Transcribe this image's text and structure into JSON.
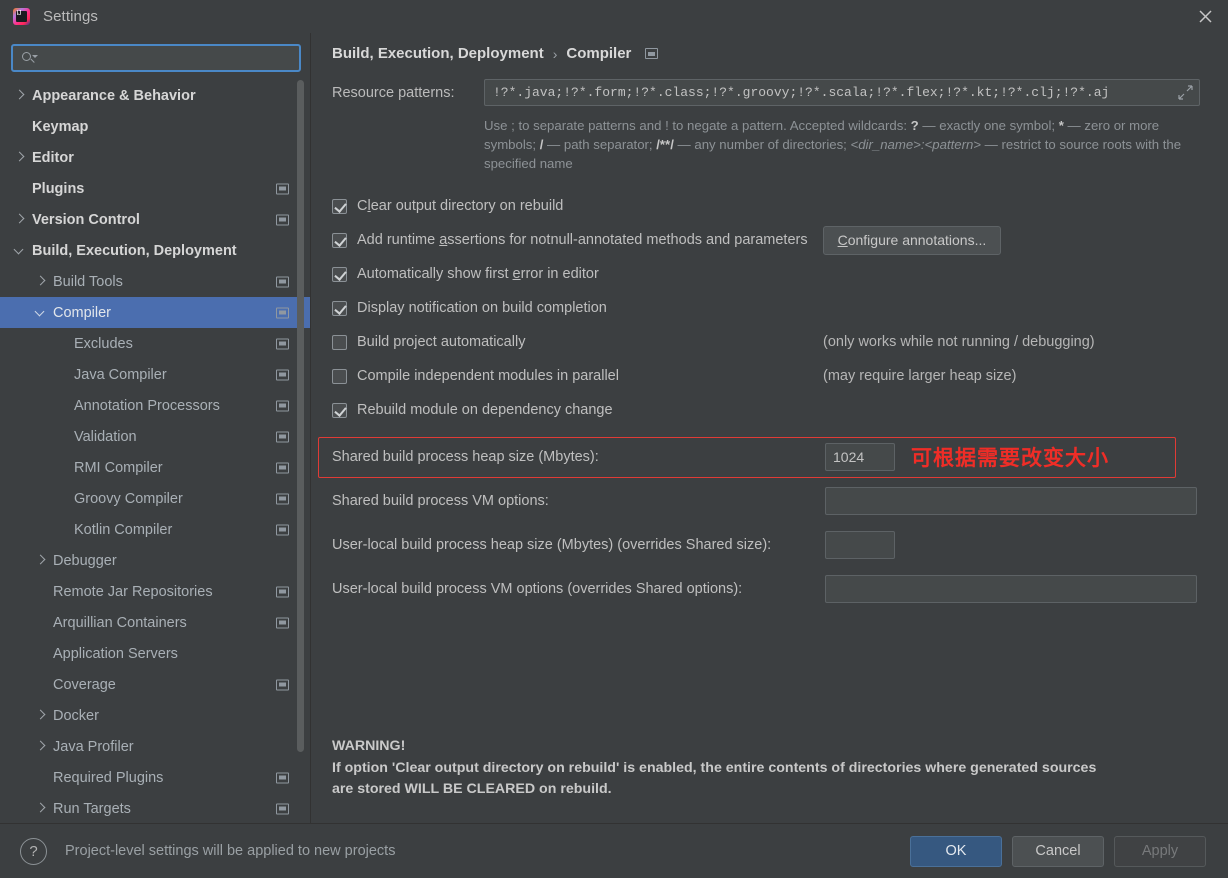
{
  "window": {
    "title": "Settings",
    "logo_icon": "intellij-idea-logo",
    "close_icon": "close-icon"
  },
  "search": {
    "placeholder": "",
    "value": "",
    "icon": "search-icon",
    "caret_icon": "chevron-down-icon"
  },
  "sidebar": {
    "items": [
      {
        "label": "Appearance & Behavior",
        "arrow": "right",
        "indent": 0,
        "top": true,
        "module": false
      },
      {
        "label": "Keymap",
        "arrow": "none",
        "indent": 0,
        "top": true,
        "module": false
      },
      {
        "label": "Editor",
        "arrow": "right",
        "indent": 0,
        "top": true,
        "module": false
      },
      {
        "label": "Plugins",
        "arrow": "none",
        "indent": 0,
        "top": true,
        "module": true
      },
      {
        "label": "Version Control",
        "arrow": "right",
        "indent": 0,
        "top": true,
        "module": true
      },
      {
        "label": "Build, Execution, Deployment",
        "arrow": "down",
        "indent": 0,
        "top": true,
        "module": false
      },
      {
        "label": "Build Tools",
        "arrow": "right",
        "indent": 1,
        "top": false,
        "module": true
      },
      {
        "label": "Compiler",
        "arrow": "down",
        "indent": 1,
        "top": false,
        "module": true,
        "selected": true
      },
      {
        "label": "Excludes",
        "arrow": "none",
        "indent": 2,
        "top": false,
        "module": true
      },
      {
        "label": "Java Compiler",
        "arrow": "none",
        "indent": 2,
        "top": false,
        "module": true
      },
      {
        "label": "Annotation Processors",
        "arrow": "none",
        "indent": 2,
        "top": false,
        "module": true
      },
      {
        "label": "Validation",
        "arrow": "none",
        "indent": 2,
        "top": false,
        "module": true
      },
      {
        "label": "RMI Compiler",
        "arrow": "none",
        "indent": 2,
        "top": false,
        "module": true
      },
      {
        "label": "Groovy Compiler",
        "arrow": "none",
        "indent": 2,
        "top": false,
        "module": true
      },
      {
        "label": "Kotlin Compiler",
        "arrow": "none",
        "indent": 2,
        "top": false,
        "module": true
      },
      {
        "label": "Debugger",
        "arrow": "right",
        "indent": 1,
        "top": false,
        "module": false
      },
      {
        "label": "Remote Jar Repositories",
        "arrow": "none",
        "indent": 1,
        "top": false,
        "module": true
      },
      {
        "label": "Arquillian Containers",
        "arrow": "none",
        "indent": 1,
        "top": false,
        "module": true
      },
      {
        "label": "Application Servers",
        "arrow": "none",
        "indent": 1,
        "top": false,
        "module": false
      },
      {
        "label": "Coverage",
        "arrow": "none",
        "indent": 1,
        "top": false,
        "module": true
      },
      {
        "label": "Docker",
        "arrow": "right",
        "indent": 1,
        "top": false,
        "module": false
      },
      {
        "label": "Java Profiler",
        "arrow": "right",
        "indent": 1,
        "top": false,
        "module": false
      },
      {
        "label": "Required Plugins",
        "arrow": "none",
        "indent": 1,
        "top": false,
        "module": true
      },
      {
        "label": "Run Targets",
        "arrow": "right",
        "indent": 1,
        "top": false,
        "module": true
      }
    ]
  },
  "main": {
    "breadcrumb": {
      "root": "Build, Execution, Deployment",
      "separator": "›",
      "current": "Compiler",
      "icon": "module-icon"
    },
    "resource_patterns": {
      "label": "Resource patterns:",
      "value": "!?*.java;!?*.form;!?*.class;!?*.groovy;!?*.scala;!?*.flex;!?*.kt;!?*.clj;!?*.aj",
      "expand_icon": "expand-icon",
      "hint_line1_a": "Use ; to separate patterns and ! to negate a pattern. Accepted wildcards: ",
      "hint_b1": "?",
      "hint_line1_b": " — exactly one symbol; ",
      "hint_b2": "*",
      "hint_line1_c": " — zero or more symbols; ",
      "hint_b3": "/",
      "hint_line1_d": " — path separator; ",
      "hint_b4": "/**/",
      "hint_line1_e": " — any number of directories; ",
      "hint_i1": "<dir_name>:<pattern>",
      "hint_line1_f": " — restrict to source roots with the specified name"
    },
    "checkboxes": [
      {
        "label_pre": "C",
        "mnemonic": "l",
        "label_post": "ear output directory on rebuild",
        "checked": true,
        "note": "",
        "button": ""
      },
      {
        "label_pre": "Add runtime ",
        "mnemonic": "a",
        "label_post": "ssertions for notnull-annotated methods and parameters",
        "checked": true,
        "note": "",
        "button": "Configure annotations..."
      },
      {
        "label_pre": "Automatically show first ",
        "mnemonic": "e",
        "label_post": "rror in editor",
        "checked": true,
        "note": "",
        "button": ""
      },
      {
        "label_pre": "Display notification on build completion",
        "mnemonic": "",
        "label_post": "",
        "checked": true,
        "note": "",
        "button": ""
      },
      {
        "label_pre": "Build project automatically",
        "mnemonic": "",
        "label_post": "",
        "checked": false,
        "note": "(only works while not running / debugging)",
        "button": ""
      },
      {
        "label_pre": "Compile independent modules in parallel",
        "mnemonic": "",
        "label_post": "",
        "checked": false,
        "note": "(may require larger heap size)",
        "button": ""
      },
      {
        "label_pre": "Rebuild module on dependency change",
        "mnemonic": "",
        "label_post": "",
        "checked": true,
        "note": "",
        "button": ""
      }
    ],
    "fields": [
      {
        "label": "Shared build process heap size (Mbytes):",
        "value": "1024",
        "size": "small",
        "highlight": true,
        "annotation": "可根据需要改变大小"
      },
      {
        "label": "Shared build process VM options:",
        "value": "",
        "size": "wide",
        "highlight": false,
        "annotation": ""
      },
      {
        "label": "User-local build process heap size (Mbytes) (overrides Shared size):",
        "value": "",
        "size": "small",
        "highlight": false,
        "annotation": ""
      },
      {
        "label": "User-local build process VM options (overrides Shared options):",
        "value": "",
        "size": "wide",
        "highlight": false,
        "annotation": ""
      }
    ],
    "warning": {
      "title": "WARNING!",
      "line1": "If option 'Clear output directory on rebuild' is enabled, the entire contents of directories where generated sources",
      "line2": "are stored WILL BE CLEARED on rebuild."
    }
  },
  "bottom": {
    "help_icon": "help-icon",
    "note": "Project-level settings will be applied to new projects",
    "ok": "OK",
    "cancel": "Cancel",
    "apply": "Apply"
  },
  "colors": {
    "background": "#3c3f41",
    "selection": "#4b6eaf",
    "primary_button": "#365880",
    "annotation_red": "#ef2d27",
    "highlight_border": "#e03b36",
    "focus_border": "#4a88c7"
  }
}
